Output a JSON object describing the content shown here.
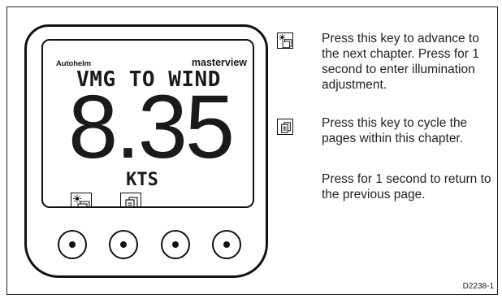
{
  "instrument": {
    "brand": "Autohelm",
    "product": "masterview",
    "mode": "VMG TO WIND",
    "reading": "8.35",
    "units": "KTS",
    "keys": [
      {
        "icon": "illumination-chapter-key-icon"
      },
      {
        "icon": "page-cycle-key-icon"
      }
    ]
  },
  "legend": [
    {
      "icon": "illumination-chapter-key-icon",
      "text": "Press this key to advance to the next chapter. Press for 1 second to enter illumination adjustment."
    },
    {
      "icon": "page-cycle-key-icon",
      "text": "Press this key to cycle the pages within this chapter."
    }
  ],
  "legend_note": "Press for 1 second to return to the previous page.",
  "figure_ref": "D2238-1"
}
